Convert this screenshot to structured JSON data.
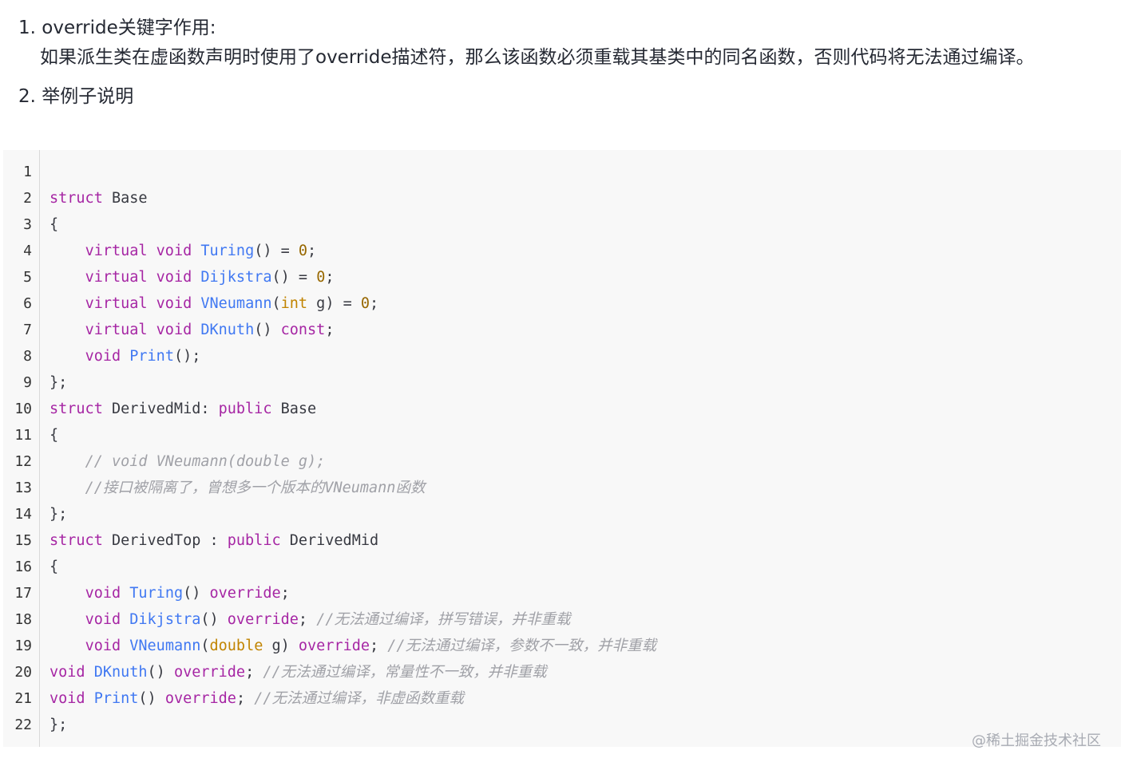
{
  "list": {
    "items": [
      {
        "number": "1.",
        "title": "override关键字作用:",
        "desc": "如果派生类在虚函数声明时使用了override描述符，那么该函数必须重载其基类中的同名函数，否则代码将无法通过编译。"
      },
      {
        "number": "2.",
        "title": "举例子说明"
      }
    ]
  },
  "code": {
    "line_numbers": [
      "1",
      "2",
      "3",
      "4",
      "5",
      "6",
      "7",
      "8",
      "9",
      "10",
      "11",
      "12",
      "13",
      "14",
      "15",
      "16",
      "17",
      "18",
      "19",
      "20",
      "21",
      "22"
    ],
    "lines": [
      [],
      [
        {
          "t": "struct",
          "c": "kw"
        },
        {
          "t": " Base",
          "c": ""
        }
      ],
      [
        {
          "t": "{",
          "c": ""
        }
      ],
      [
        {
          "t": "    ",
          "c": ""
        },
        {
          "t": "virtual",
          "c": "kw"
        },
        {
          "t": " ",
          "c": ""
        },
        {
          "t": "void",
          "c": "kw"
        },
        {
          "t": " ",
          "c": ""
        },
        {
          "t": "Turing",
          "c": "fn"
        },
        {
          "t": "() = ",
          "c": ""
        },
        {
          "t": "0",
          "c": "num"
        },
        {
          "t": ";",
          "c": ""
        }
      ],
      [
        {
          "t": "    ",
          "c": ""
        },
        {
          "t": "virtual",
          "c": "kw"
        },
        {
          "t": " ",
          "c": ""
        },
        {
          "t": "void",
          "c": "kw"
        },
        {
          "t": " ",
          "c": ""
        },
        {
          "t": "Dijkstra",
          "c": "fn"
        },
        {
          "t": "() = ",
          "c": ""
        },
        {
          "t": "0",
          "c": "num"
        },
        {
          "t": ";",
          "c": ""
        }
      ],
      [
        {
          "t": "    ",
          "c": ""
        },
        {
          "t": "virtual",
          "c": "kw"
        },
        {
          "t": " ",
          "c": ""
        },
        {
          "t": "void",
          "c": "kw"
        },
        {
          "t": " ",
          "c": ""
        },
        {
          "t": "VNeumann",
          "c": "fn"
        },
        {
          "t": "(",
          "c": ""
        },
        {
          "t": "int",
          "c": "ty"
        },
        {
          "t": " g) = ",
          "c": ""
        },
        {
          "t": "0",
          "c": "num"
        },
        {
          "t": ";",
          "c": ""
        }
      ],
      [
        {
          "t": "    ",
          "c": ""
        },
        {
          "t": "virtual",
          "c": "kw"
        },
        {
          "t": " ",
          "c": ""
        },
        {
          "t": "void",
          "c": "kw"
        },
        {
          "t": " ",
          "c": ""
        },
        {
          "t": "DKnuth",
          "c": "fn"
        },
        {
          "t": "() ",
          "c": ""
        },
        {
          "t": "const",
          "c": "kw"
        },
        {
          "t": ";",
          "c": ""
        }
      ],
      [
        {
          "t": "    ",
          "c": ""
        },
        {
          "t": "void",
          "c": "kw"
        },
        {
          "t": " ",
          "c": ""
        },
        {
          "t": "Print",
          "c": "fn"
        },
        {
          "t": "();",
          "c": ""
        }
      ],
      [
        {
          "t": "};",
          "c": ""
        }
      ],
      [
        {
          "t": "struct",
          "c": "kw"
        },
        {
          "t": " DerivedMid: ",
          "c": ""
        },
        {
          "t": "public",
          "c": "kw"
        },
        {
          "t": " Base",
          "c": ""
        }
      ],
      [
        {
          "t": "{",
          "c": ""
        }
      ],
      [
        {
          "t": "    ",
          "c": ""
        },
        {
          "t": "// void VNeumann(double g);",
          "c": "cm"
        }
      ],
      [
        {
          "t": "    ",
          "c": ""
        },
        {
          "t": "//接口被隔离了，曾想多一个版本的VNeumann函数",
          "c": "cm"
        }
      ],
      [
        {
          "t": "};",
          "c": ""
        }
      ],
      [
        {
          "t": "struct",
          "c": "kw"
        },
        {
          "t": " DerivedTop : ",
          "c": ""
        },
        {
          "t": "public",
          "c": "kw"
        },
        {
          "t": " DerivedMid",
          "c": ""
        }
      ],
      [
        {
          "t": "{",
          "c": ""
        }
      ],
      [
        {
          "t": "    ",
          "c": ""
        },
        {
          "t": "void",
          "c": "kw"
        },
        {
          "t": " ",
          "c": ""
        },
        {
          "t": "Turing",
          "c": "fn"
        },
        {
          "t": "() ",
          "c": ""
        },
        {
          "t": "override",
          "c": "kw"
        },
        {
          "t": ";",
          "c": ""
        }
      ],
      [
        {
          "t": "    ",
          "c": ""
        },
        {
          "t": "void",
          "c": "kw"
        },
        {
          "t": " ",
          "c": ""
        },
        {
          "t": "Dikjstra",
          "c": "fn"
        },
        {
          "t": "() ",
          "c": ""
        },
        {
          "t": "override",
          "c": "kw"
        },
        {
          "t": "; ",
          "c": ""
        },
        {
          "t": "//无法通过编译，拼写错误，并非重载",
          "c": "cm"
        }
      ],
      [
        {
          "t": "    ",
          "c": ""
        },
        {
          "t": "void",
          "c": "kw"
        },
        {
          "t": " ",
          "c": ""
        },
        {
          "t": "VNeumann",
          "c": "fn"
        },
        {
          "t": "(",
          "c": ""
        },
        {
          "t": "double",
          "c": "ty"
        },
        {
          "t": " g) ",
          "c": ""
        },
        {
          "t": "override",
          "c": "kw"
        },
        {
          "t": "; ",
          "c": ""
        },
        {
          "t": "//无法通过编译，参数不一致，并非重载",
          "c": "cm"
        }
      ],
      [
        {
          "t": "void",
          "c": "kw"
        },
        {
          "t": " ",
          "c": ""
        },
        {
          "t": "DKnuth",
          "c": "fn"
        },
        {
          "t": "() ",
          "c": ""
        },
        {
          "t": "override",
          "c": "kw"
        },
        {
          "t": "; ",
          "c": ""
        },
        {
          "t": "//无法通过编译，常量性不一致，并非重载",
          "c": "cm"
        }
      ],
      [
        {
          "t": "void",
          "c": "kw"
        },
        {
          "t": " ",
          "c": ""
        },
        {
          "t": "Print",
          "c": "fn"
        },
        {
          "t": "() ",
          "c": ""
        },
        {
          "t": "override",
          "c": "kw"
        },
        {
          "t": "; ",
          "c": ""
        },
        {
          "t": "//无法通过编译，非虚函数重载",
          "c": "cm"
        }
      ],
      [
        {
          "t": "};",
          "c": ""
        }
      ]
    ]
  },
  "watermark": "@稀土掘金技术社区"
}
